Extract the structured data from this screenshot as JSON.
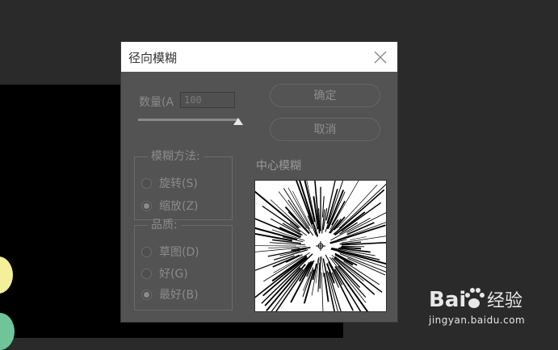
{
  "window": {
    "title": "径向模糊"
  },
  "amount": {
    "label": "数量(A",
    "value": "100",
    "slider_fraction": 1.0
  },
  "buttons": {
    "ok": "确定",
    "cancel": "取消"
  },
  "blur_method": {
    "legend": "模糊方法:",
    "options": [
      {
        "label": "旋转(S)",
        "selected": false
      },
      {
        "label": "缩放(Z)",
        "selected": true
      }
    ]
  },
  "quality": {
    "legend": "品质:",
    "options": [
      {
        "label": "草图(D)",
        "selected": false
      },
      {
        "label": "好(G)",
        "selected": false
      },
      {
        "label": "最好(B)",
        "selected": true
      }
    ]
  },
  "center": {
    "title": "中心模糊"
  },
  "watermark": {
    "brand": "Baidu经验",
    "url": "jingyan.baidu.com"
  },
  "colors": {
    "dialog_bg": "#535353",
    "titlebar_bg": "#ffffff",
    "canvas_bg": "#000000",
    "swatch_yellow": "#f4f09a",
    "swatch_green": "#6fc49a"
  }
}
